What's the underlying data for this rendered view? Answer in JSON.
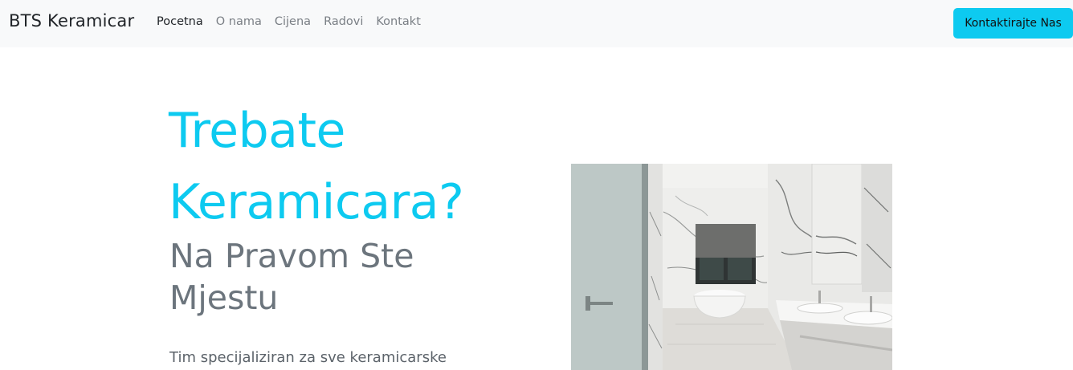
{
  "navbar": {
    "brand": "BTS Keramicar",
    "links": [
      {
        "label": "Pocetna",
        "active": true
      },
      {
        "label": "O nama",
        "active": false
      },
      {
        "label": "Cijena",
        "active": false
      },
      {
        "label": "Radovi",
        "active": false
      },
      {
        "label": "Kontakt",
        "active": false
      }
    ],
    "cta_label": "Kontaktirajte Nas"
  },
  "hero": {
    "title": "Trebate Keramicara?",
    "subtitle": "Na Pravom Ste Mjestu",
    "text": "Tim specijaliziran za sve keramicarske",
    "image_subject": "bathroom-photo"
  },
  "colors": {
    "accent": "#0dcaf0",
    "navbar_bg": "#f8f9fa",
    "muted_text": "#6c757d"
  }
}
